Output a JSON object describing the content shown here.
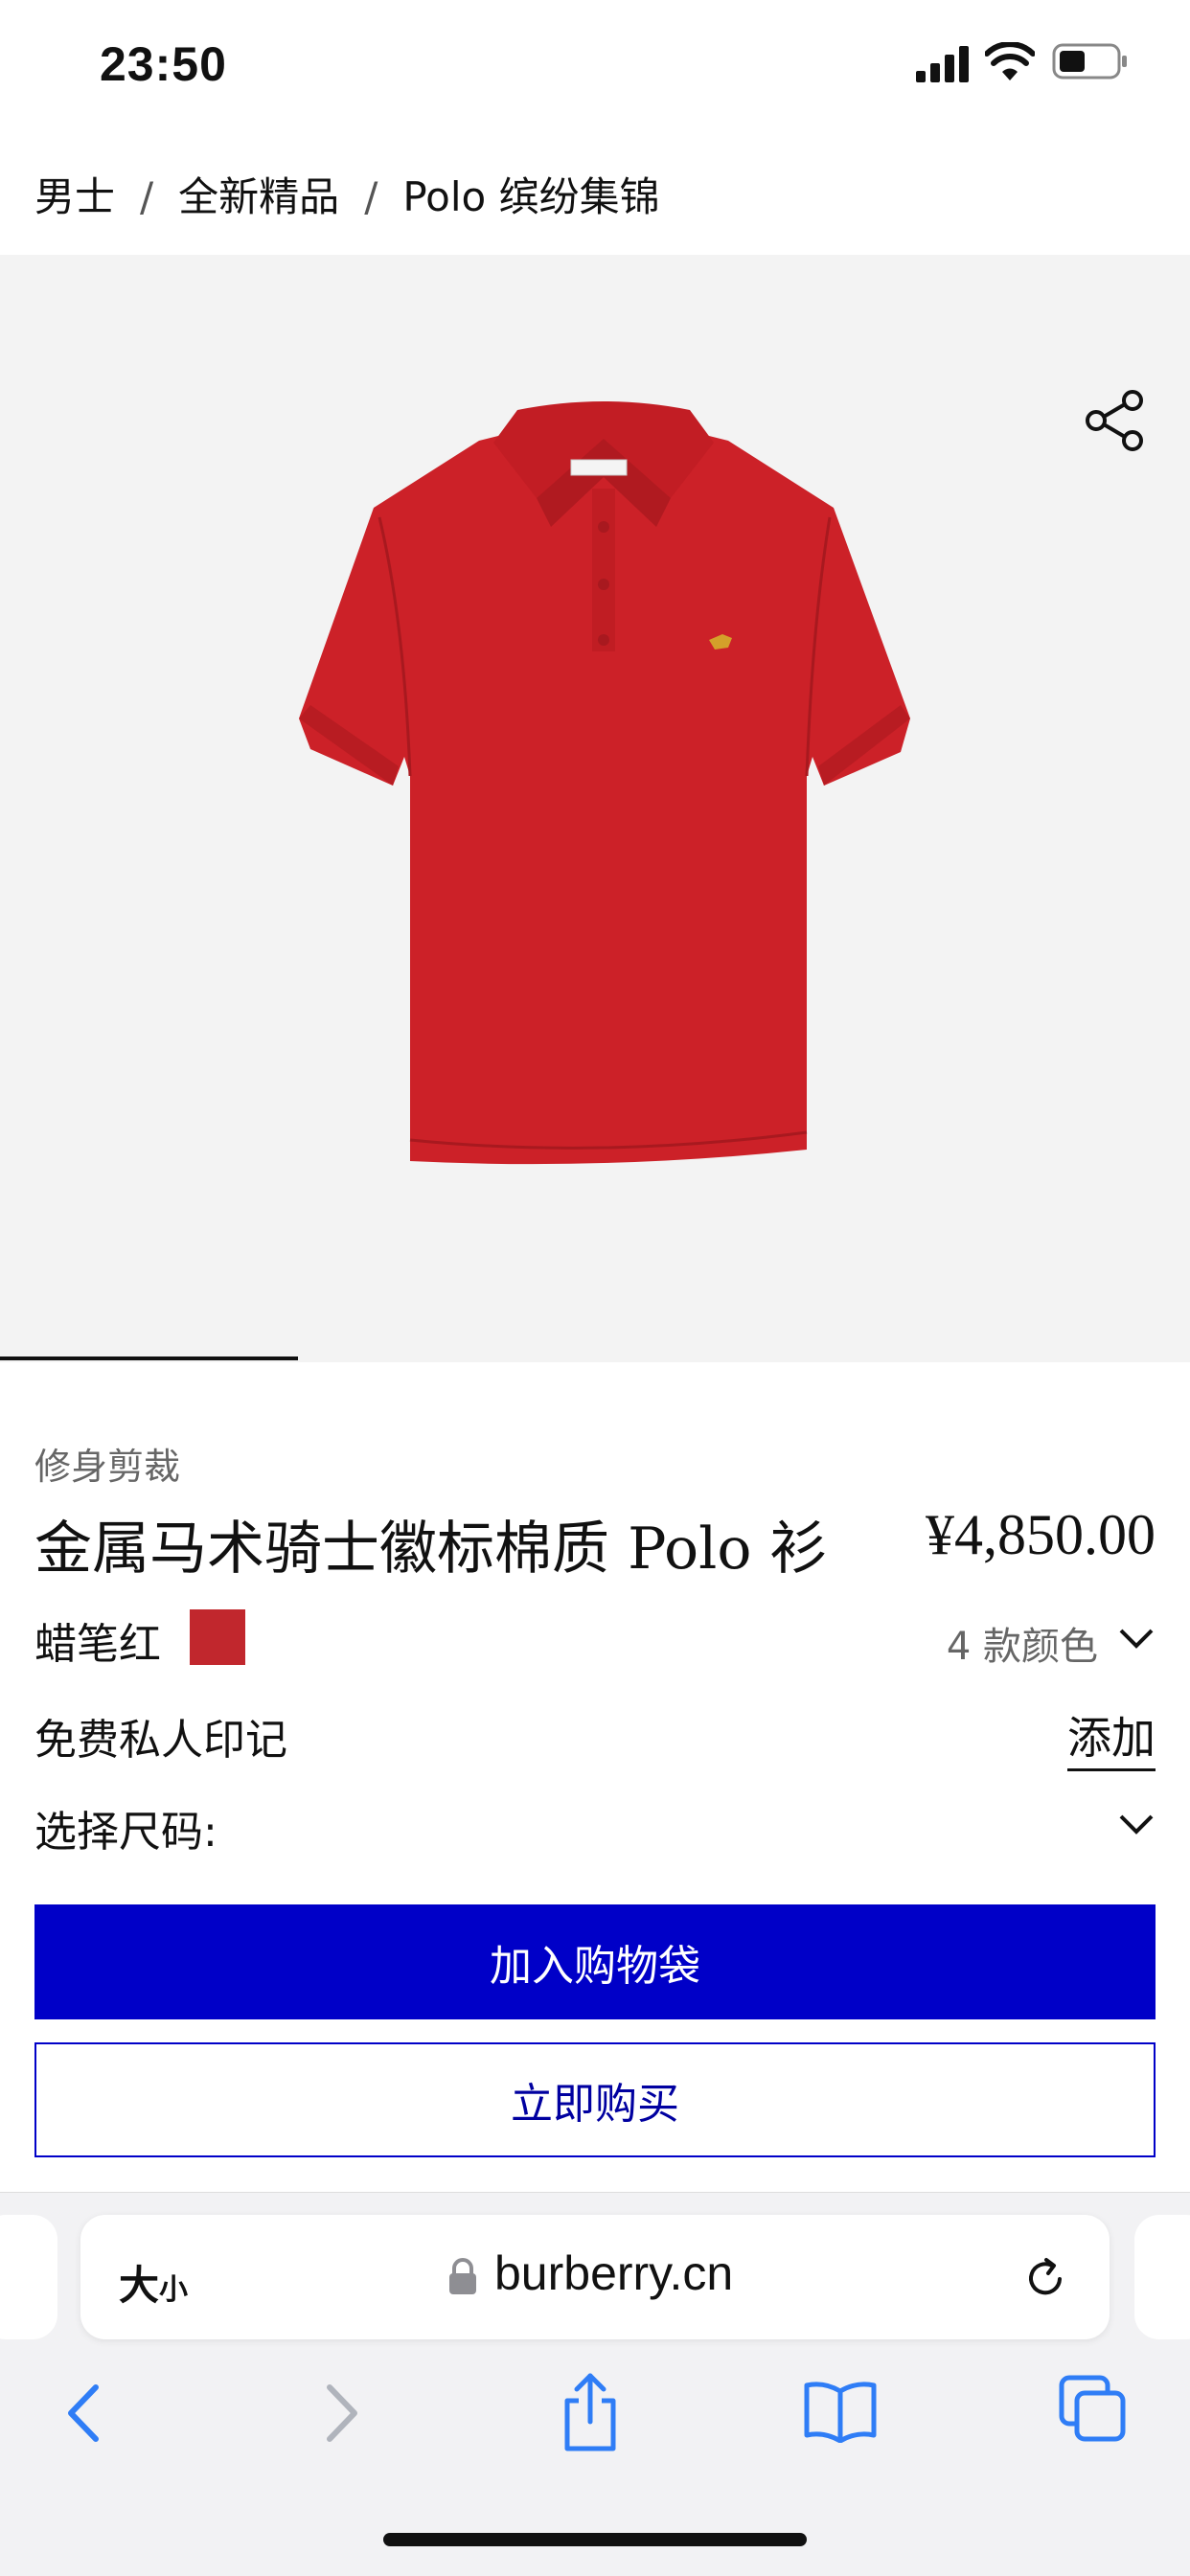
{
  "status_bar": {
    "time": "23:50"
  },
  "breadcrumb": {
    "items": [
      "男士",
      "全新精品",
      "Polo 缤纷集锦"
    ],
    "separator": "/"
  },
  "product": {
    "fit": "修身剪裁",
    "name": "金属马术骑士徽标棉质 Polo 衫",
    "price": "¥4,850.00",
    "color_name": "蜡笔红",
    "color_swatch": "#c1272d",
    "color_count": "4 款颜色",
    "monogram_label": "免费私人印记",
    "monogram_action": "添加",
    "size_label": "选择尺码:",
    "add_to_bag": "加入购物袋",
    "buy_now": "立即购买",
    "gallery_progress": 0.25
  },
  "browser": {
    "text_size_big": "大",
    "text_size_small": "小",
    "url": "burberry.cn",
    "icons": [
      "lock-icon",
      "reload-icon",
      "back-icon",
      "forward-icon",
      "share-icon",
      "bookmarks-icon",
      "tabs-icon"
    ]
  },
  "colors": {
    "accent_blue": "#0000c8",
    "shirt_red": "#cc2128"
  }
}
